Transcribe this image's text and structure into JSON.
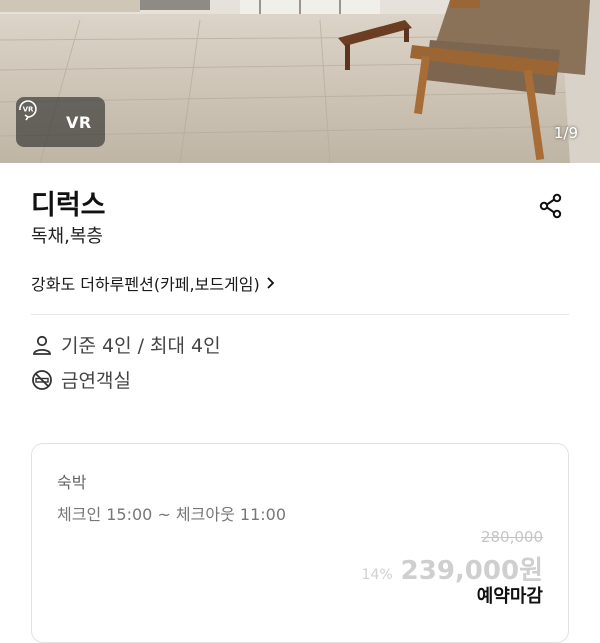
{
  "hero": {
    "vr_label": "VR",
    "photo_counter": "1/9",
    "icons": {
      "vr": "vr-360-icon"
    }
  },
  "room": {
    "title": "디럭스",
    "type": "독채,복층",
    "lodging_name": "강화도 더하루펜션(카페,보드게임)",
    "icons": {
      "share": "share-icon",
      "chevron": "chevron-right-icon"
    }
  },
  "features": [
    {
      "icon": "person-icon",
      "text": "기준 4인 / 최대 4인"
    },
    {
      "icon": "no-smoking-icon",
      "text": "금연객실"
    }
  ],
  "stay": {
    "label": "숙박",
    "times": "체크인 15:00 ~ 체크아웃 11:00",
    "original_price": "280,000",
    "discount": "14%",
    "sale_price": "239,000원",
    "status": "예약마감"
  },
  "colors": {
    "price_disabled": "#cfcfcf",
    "divider": "#e8e8e8",
    "badge_bg": "#282828"
  }
}
